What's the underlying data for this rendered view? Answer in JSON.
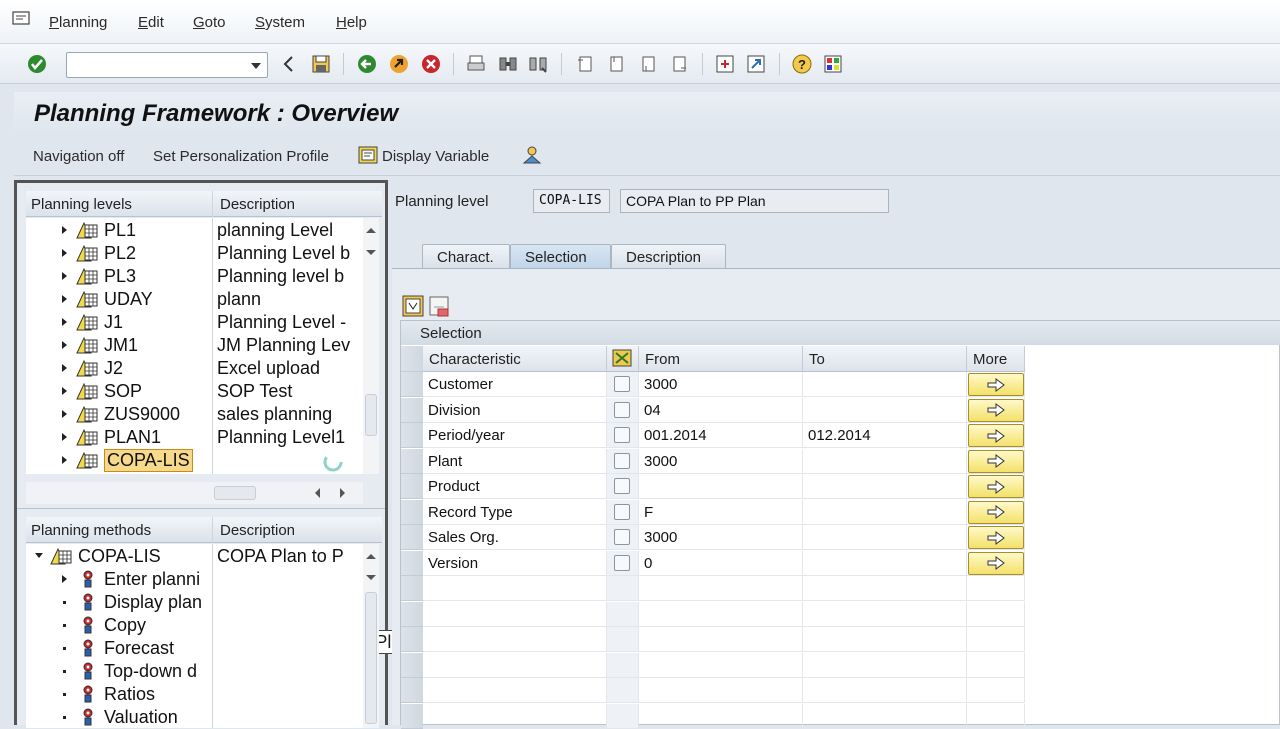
{
  "menu": [
    "Planning",
    "Edit",
    "Goto",
    "System",
    "Help"
  ],
  "toolbar": {
    "icons": [
      "enter-icon",
      "back-nav-icon",
      "save-icon",
      "back-icon",
      "exit-icon",
      "cancel-icon",
      "print-icon",
      "find-icon",
      "find-next-icon",
      "first-page-icon",
      "prev-page-icon",
      "next-page-icon",
      "last-page-icon",
      "create-session-icon",
      "shortcut-icon",
      "help-icon",
      "layout-icon"
    ]
  },
  "title": "Planning Framework : Overview",
  "app_toolbar": {
    "nav_off": "Navigation off",
    "personalization": "Set Personalization Profile",
    "display_variable": "Display Variable"
  },
  "levels": {
    "col_name": "Planning levels",
    "col_desc": "Description",
    "rows": [
      {
        "name": "PL1",
        "desc": "planning Level"
      },
      {
        "name": "PL2",
        "desc": "Planning Level b"
      },
      {
        "name": "PL3",
        "desc": "Planning level b"
      },
      {
        "name": "UDAY",
        "desc": "plann"
      },
      {
        "name": "J1",
        "desc": "Planning Level -"
      },
      {
        "name": "JM1",
        "desc": "JM Planning Lev"
      },
      {
        "name": "J2",
        "desc": "Excel upload"
      },
      {
        "name": "SOP",
        "desc": "SOP Test"
      },
      {
        "name": "ZUS9000",
        "desc": "sales planning"
      },
      {
        "name": "PLAN1",
        "desc": "Planning Level1"
      },
      {
        "name": "COPA-LIS",
        "desc": "COPA Plan to PP Plan"
      }
    ],
    "tooltip": "COPA Plan to PP Plan"
  },
  "methods": {
    "col_name": "Planning methods",
    "col_desc": "Description",
    "root": {
      "name": "COPA-LIS",
      "desc": "COPA Plan to P"
    },
    "items": [
      "Enter planni",
      "Display plan",
      "Copy",
      "Forecast",
      "Top-down d",
      "Ratios",
      "Valuation"
    ]
  },
  "detail": {
    "level_label": "Planning level",
    "level_code": "COPA-LIS",
    "level_desc": "COPA Plan to PP Plan",
    "tabs": [
      "Charact.",
      "Selection",
      "Description"
    ],
    "active_tab": "Selection",
    "section_title": "Selection",
    "columns": [
      "Characteristic",
      "From",
      "To",
      "More"
    ],
    "rows": [
      {
        "char": "Customer",
        "from": "3000",
        "to": ""
      },
      {
        "char": "Division",
        "from": "04",
        "to": ""
      },
      {
        "char": "Period/year",
        "from": "001.2014",
        "to": "012.2014"
      },
      {
        "char": "Plant",
        "from": "3000",
        "to": ""
      },
      {
        "char": "Product",
        "from": "",
        "to": ""
      },
      {
        "char": "Record Type",
        "from": "F",
        "to": ""
      },
      {
        "char": "Sales Org.",
        "from": "3000",
        "to": ""
      },
      {
        "char": "Version",
        "from": "0",
        "to": ""
      }
    ]
  }
}
